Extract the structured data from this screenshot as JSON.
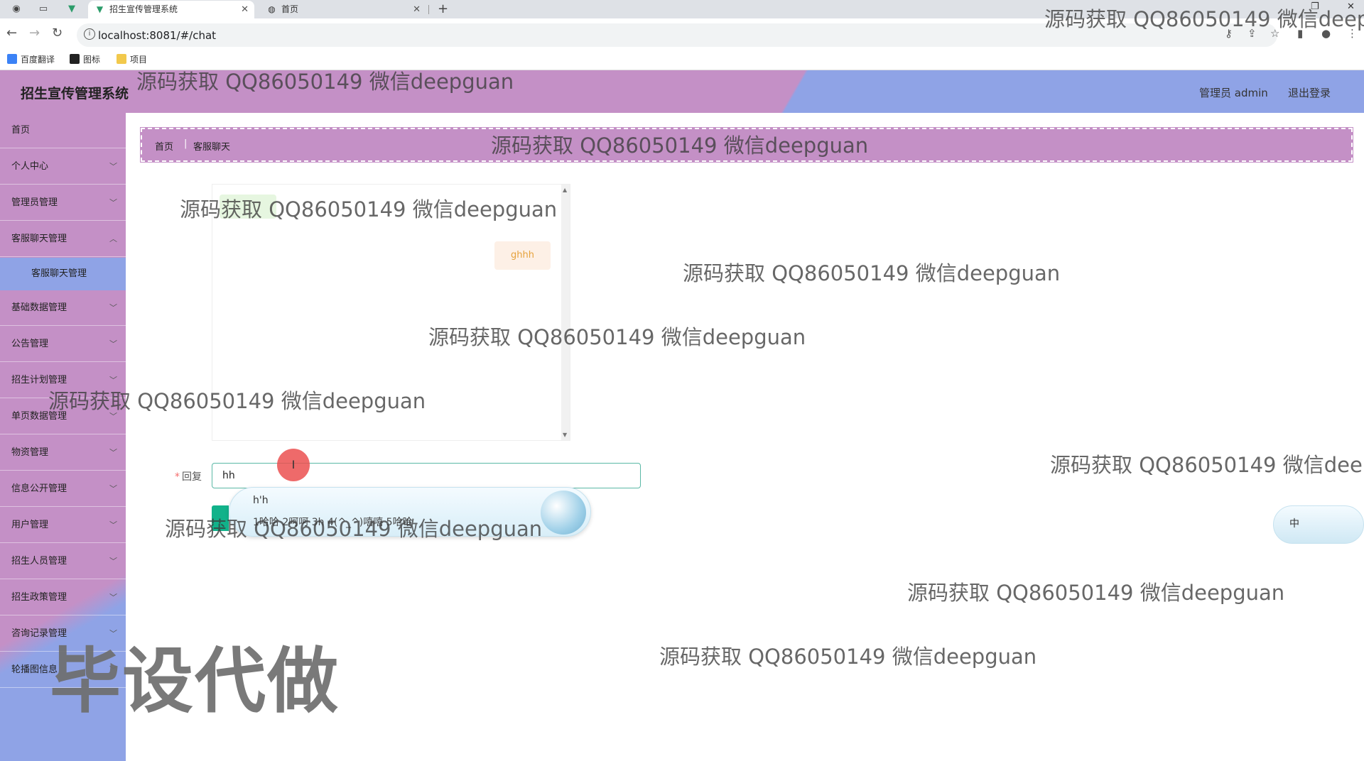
{
  "browser": {
    "tabs": [
      {
        "label": "招生宣传管理系统",
        "active": true
      },
      {
        "label": "首页",
        "active": false
      }
    ],
    "url": "localhost:8081/#/chat",
    "bookmarks": [
      "百度翻译",
      "图标",
      "项目"
    ]
  },
  "header": {
    "title": "招生宣传管理系统",
    "user": "管理员 admin",
    "logout": "退出登录"
  },
  "sidebar": {
    "items": [
      {
        "label": "首页",
        "has_children": false
      },
      {
        "label": "个人中心",
        "has_children": true
      },
      {
        "label": "管理员管理",
        "has_children": true
      },
      {
        "label": "客服聊天管理",
        "has_children": true,
        "expanded": true,
        "children": [
          "客服聊天管理"
        ]
      },
      {
        "label": "基础数据管理",
        "has_children": true
      },
      {
        "label": "公告管理",
        "has_children": true
      },
      {
        "label": "招生计划管理",
        "has_children": true
      },
      {
        "label": "单页数据管理",
        "has_children": true
      },
      {
        "label": "物资管理",
        "has_children": true
      },
      {
        "label": "信息公开管理",
        "has_children": true
      },
      {
        "label": "用户管理",
        "has_children": true
      },
      {
        "label": "招生人员管理",
        "has_children": true
      },
      {
        "label": "招生政策管理",
        "has_children": true
      },
      {
        "label": "咨询记录管理",
        "has_children": true
      },
      {
        "label": "轮播图信息",
        "has_children": true
      }
    ]
  },
  "breadcrumb": [
    "首页",
    "客服聊天"
  ],
  "chat": {
    "messages": [
      {
        "side": "left",
        "text": ""
      },
      {
        "side": "right",
        "text": "ghhh"
      }
    ]
  },
  "reply": {
    "required_mark": "*",
    "label": "回复",
    "value": "hh"
  },
  "ime": {
    "composition": "h'h",
    "candidates": "1哈哈  2呵呵  3h  4(^_^)嘻嘻  5哈哈",
    "tray_label": "中"
  },
  "watermark": {
    "text": "源码获取 QQ86050149 微信deepguan",
    "big_text": "毕设代做"
  },
  "colors": {
    "header_purple": "#c490c6",
    "header_blue": "#8fa3e6",
    "input_border": "#5ab8a5",
    "send_green": "#11b28a",
    "reply_bubble_text": "#e6a23c"
  }
}
